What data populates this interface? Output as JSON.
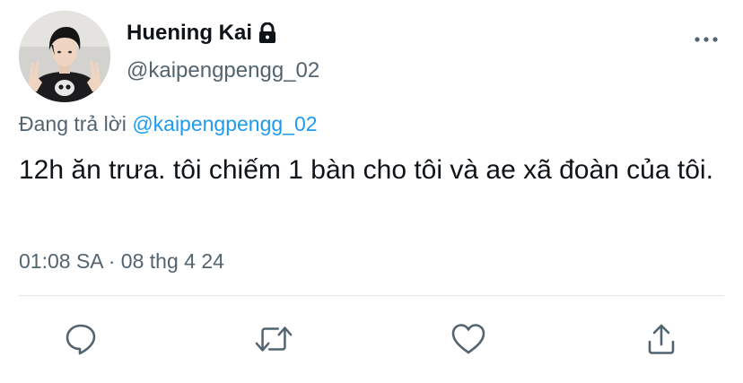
{
  "tweet": {
    "author": {
      "display_name": "Huening Kai",
      "handle": "@kaipengpengg_02",
      "protected": true
    },
    "reply": {
      "prefix": "Đang trả lời",
      "mention": "@kaipengpengg_02"
    },
    "text": "12h ăn trưa. tôi chiếm 1 bàn cho tôi và ae xã đoàn của tôi.",
    "timestamp": "01:08 SA · 08 thg 4 24"
  },
  "icons": {
    "more": "more-icon",
    "lock": "lock-icon",
    "reply": "reply-icon",
    "retweet": "retweet-icon",
    "like": "heart-icon",
    "share": "share-icon"
  },
  "colors": {
    "text": "#0f1419",
    "secondary": "#536471",
    "link": "#1d9bf0",
    "icon": "#536471",
    "divider": "#e4e6e8"
  }
}
